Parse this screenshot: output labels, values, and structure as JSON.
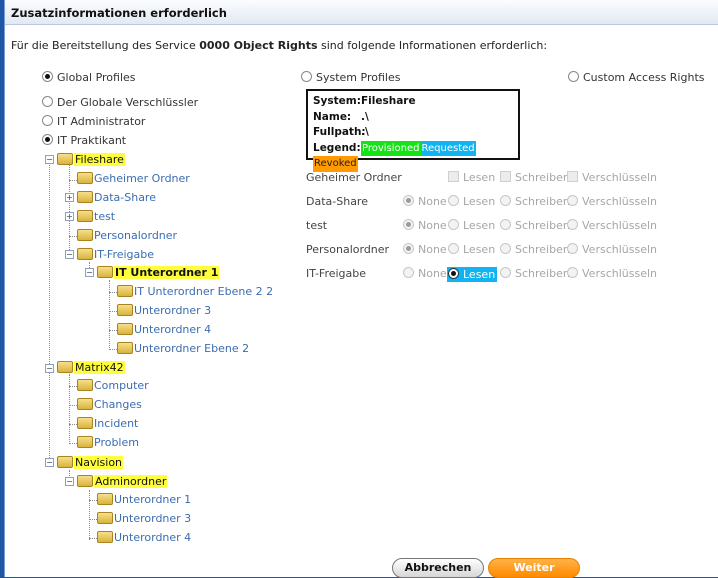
{
  "dialog": {
    "title": "Zusatzinformationen erforderlich",
    "subtitle_prefix": "Für die Bereitstellung des Service ",
    "service_name": "0000 Object Rights",
    "subtitle_suffix": " sind folgende Informationen erforderlich:"
  },
  "profile_types": {
    "global": "Global Profiles",
    "system": "System Profiles",
    "custom": "Custom Access Rights"
  },
  "profiles": [
    "Der Globale Verschlüssler",
    "IT Administrator",
    "IT Praktikant"
  ],
  "info": {
    "system_label": "System:",
    "system_value": "Fileshare",
    "name_label": "Name:",
    "name_value": ".\\",
    "fullpath_label": "Fullpath:",
    "fullpath_value": ".\\",
    "legend_label": "Legend:",
    "legend_provisioned": "Provisioned",
    "legend_requested": "Requested",
    "legend_revoked": "Revoked",
    "color_provisioned": "#16e316",
    "color_requested": "#0fb4f0",
    "color_revoked": "#ff9b00"
  },
  "tree": {
    "n0": "Fileshare",
    "n1": "Geheimer Ordner",
    "n2": "Data-Share",
    "n3": "test",
    "n4": "Personalordner",
    "n5": "IT-Freigabe",
    "n6": "IT Unterordner 1",
    "n7": "IT Unterordner Ebene 2 2",
    "n8": "Unterordner 3",
    "n9": "Unterordner 4",
    "n10": "Unterordner Ebene 2",
    "n11": "Matrix42",
    "n12": "Computer",
    "n13": "Changes",
    "n14": "Incident",
    "n15": "Problem",
    "n16": "Navision",
    "n17": "Adminordner",
    "n18": "Unterordner 1",
    "n19": "Unterordner 3",
    "n20": "Unterordner 4"
  },
  "permissions": {
    "options": {
      "none": "None",
      "read": "Lesen",
      "write": "Schreiben",
      "encrypt": "Verschlüsseln"
    },
    "rows": [
      {
        "folder": "Geheimer Ordner",
        "mode": "checkbox"
      },
      {
        "folder": "Data-Share",
        "mode": "radio",
        "selected": "None"
      },
      {
        "folder": "test",
        "mode": "radio",
        "selected": "None"
      },
      {
        "folder": "Personalordner",
        "mode": "radio",
        "selected": "None"
      },
      {
        "folder": "IT-Freigabe",
        "mode": "radio",
        "selected": "Lesen",
        "selected_status": "Requested"
      }
    ]
  },
  "buttons": {
    "cancel": "Abbrechen",
    "next": "Weiter"
  }
}
